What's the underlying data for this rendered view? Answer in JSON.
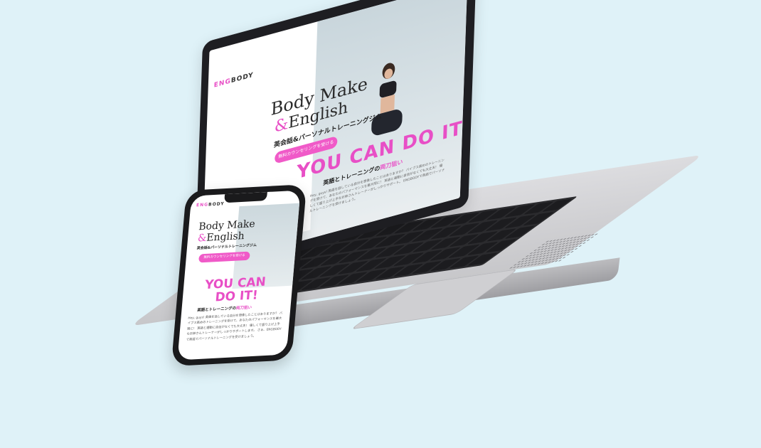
{
  "laptop_site": {
    "logo_prefix": "ENG",
    "logo_suffix": "BODY",
    "title_line1": "Body Make",
    "title_amp": "&",
    "title_line2": "English",
    "subtitle": "英会話&パーソナルトレーニングジム",
    "cta": "無料カウンセリングを受ける",
    "headline": "YOU CAN DO IT!",
    "section_prefix": "英語とトレーニングの",
    "section_highlight": "両刀狙い",
    "body": "Hey, guys! 英語を話している自分を想像したことはありますか？ バイブス高めのトレーニングを受けて、あなたのパフォーマンスを最大限に！ 英語と運動に自信がなくても大丈夫！ 優しくて盛り上げ上手なお姉さんトレーナーがしっかりサポート。 ENGBODYで英語でパーソナルトレーニングを受けましょう。"
  },
  "phone_site": {
    "logo_prefix": "ENG",
    "logo_suffix": "BODY",
    "title_line1": "Body Make",
    "title_amp": "&",
    "title_line2": "English",
    "subtitle": "英会話&パーソナルトレーニングジム",
    "cta": "無料カウンセリングを受ける",
    "headline_line1": "YOU CAN",
    "headline_line2": "DO IT!",
    "section_prefix": "英語とトレーニングの",
    "section_highlight": "両刀狙い",
    "body": "Hey, guys! 英語を話している自分を想像したことはありますか？ バイブス高めのトレーニングを受けて、あなたのパフォーマンスを最大限に！ 英語と運動に自信がなくても大丈夫！ 優しくて盛り上げ上手なお姉さんトレーナーがしっかりサポートします。 さぁ、ENGBODYで英語でパーソナルトレーニングを受けましょう。"
  },
  "colors": {
    "background": "#dff2f8",
    "accent_pink": "#e84fc6",
    "cta_pink": "#f05ac8"
  }
}
